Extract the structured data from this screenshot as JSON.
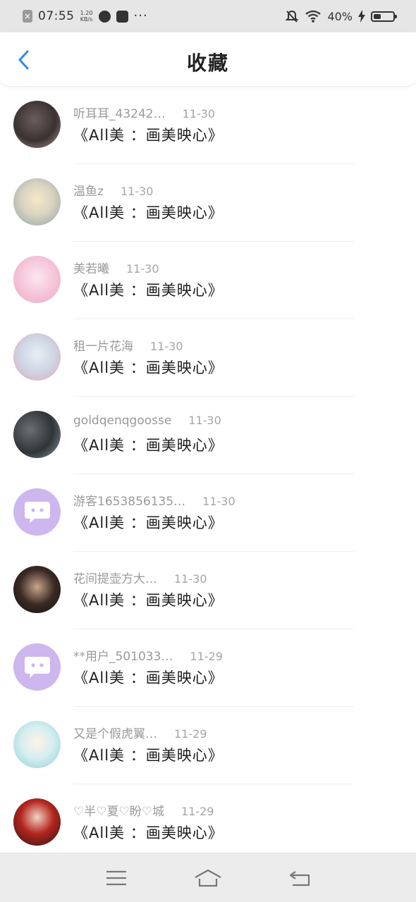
{
  "status_bar": {
    "time": "07:55",
    "net_speed_value": "1.20",
    "net_speed_unit": "KB/s",
    "more": "···",
    "battery_percent": "40%",
    "battery_level": 0.4
  },
  "header": {
    "title": "收藏"
  },
  "items": [
    {
      "name": "听耳耳_43242…",
      "date": "11-30",
      "subject": "《All美 ：画美映心》"
    },
    {
      "name": "温鱼z",
      "date": "11-30",
      "subject": "《All美 ：画美映心》"
    },
    {
      "name": "美若曦",
      "date": "11-30",
      "subject": "《All美 ：画美映心》"
    },
    {
      "name": "租一片花海",
      "date": "11-30",
      "subject": "《All美 ：画美映心》"
    },
    {
      "name": "goldqenqgoosse",
      "date": "11-30",
      "subject": "《All美 ：画美映心》"
    },
    {
      "name": "游客1653856135…",
      "date": "11-30",
      "subject": "《All美 ：画美映心》"
    },
    {
      "name": "花间提壶方大…",
      "date": "11-30",
      "subject": "《All美 ：画美映心》"
    },
    {
      "name": "**用户_501033…",
      "date": "11-29",
      "subject": "《All美 ：画美映心》"
    },
    {
      "name": "又是个假虎翼…",
      "date": "11-29",
      "subject": "《All美 ：画美映心》"
    },
    {
      "name": "♡半♡夏♡盼♡城",
      "date": "11-29",
      "subject": "《All美 ：画美映心》"
    }
  ],
  "colors": {
    "accent": "#2b8cf0",
    "chat_avatar": "#cdb7ee"
  }
}
